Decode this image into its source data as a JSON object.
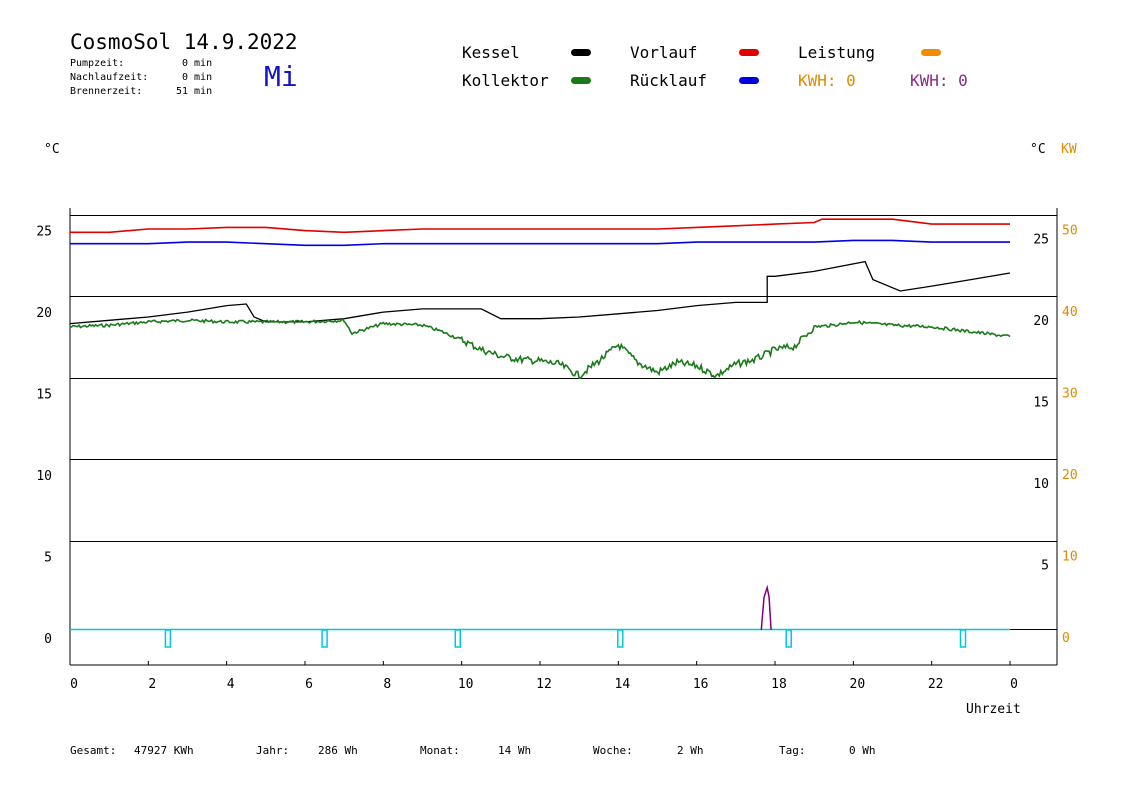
{
  "header": {
    "title": "CosmoSol 14.9.2022",
    "weekday": "Mi",
    "stats": [
      {
        "label": "Pumpzeit:",
        "value": "0 min"
      },
      {
        "label": "Nachlaufzeit:",
        "value": "0 min"
      },
      {
        "label": "Brennerzeit:",
        "value": "51 min"
      }
    ]
  },
  "legend": {
    "kessel": {
      "label": "Kessel",
      "color": "#000000"
    },
    "kollektor": {
      "label": "Kollektor",
      "color": "#1a7a1a"
    },
    "vorlauf": {
      "label": "Vorlauf",
      "color": "#e00000"
    },
    "ruecklauf": {
      "label": "Rücklauf",
      "color": "#0000e0"
    },
    "leistung": {
      "label": "Leistung",
      "color": "#f08c00"
    },
    "kwh_orange": "KWH: 0",
    "kwh_purple": "KWH: 0"
  },
  "colors": {
    "orange_text": "#e08a00",
    "purple_text": "#8a2a8a",
    "cyan": "#00c8d8",
    "purple_line": "#800080"
  },
  "axes": {
    "left_unit": "°C",
    "right_unit": "°C",
    "right_unit2": "KW",
    "xlabel": "Uhrzeit"
  },
  "footer": {
    "gesamt": {
      "label": "Gesamt:",
      "value": "47927 KWh"
    },
    "jahr": {
      "label": "Jahr:",
      "value": "286 Wh"
    },
    "monat": {
      "label": "Monat:",
      "value": "14 Wh"
    },
    "woche": {
      "label": "Woche:",
      "value": "2 Wh"
    },
    "tag": {
      "label": "Tag:",
      "value": "0 Wh"
    }
  },
  "chart_data": {
    "type": "line",
    "title": "CosmoSol 14.9.2022",
    "xlabel": "Uhrzeit",
    "ylabel": "°C",
    "xlim": [
      0,
      24
    ],
    "ylim": [
      -2,
      27
    ],
    "x_ticks": [
      "0",
      "2",
      "4",
      "6",
      "8",
      "10",
      "12",
      "14",
      "16",
      "18",
      "20",
      "22",
      "0"
    ],
    "x_tick_values": [
      0,
      2,
      4,
      6,
      8,
      10,
      12,
      14,
      16,
      18,
      20,
      22,
      24
    ],
    "y_ticks_left": [
      0,
      5,
      10,
      15,
      20,
      25
    ],
    "y_ticks_right_c": [
      5,
      10,
      15,
      20,
      25
    ],
    "y_ticks_right_kw": [
      0,
      10,
      20,
      30,
      40,
      50
    ],
    "grid": true,
    "series": [
      {
        "name": "Vorlauf",
        "color": "#e00000",
        "x": [
          0,
          1,
          2,
          3,
          4,
          5,
          6,
          7,
          8,
          9,
          10,
          11,
          12,
          13,
          14,
          15,
          16,
          17,
          18,
          19,
          19.2,
          20,
          21,
          22,
          23,
          24
        ],
        "values": [
          24.4,
          24.4,
          24.6,
          24.6,
          24.7,
          24.7,
          24.5,
          24.4,
          24.5,
          24.6,
          24.6,
          24.6,
          24.6,
          24.6,
          24.6,
          24.6,
          24.7,
          24.8,
          24.9,
          25.0,
          25.2,
          25.2,
          25.2,
          24.9,
          24.9,
          24.9
        ]
      },
      {
        "name": "Rücklauf",
        "color": "#0000e0",
        "x": [
          0,
          1,
          2,
          3,
          4,
          5,
          6,
          7,
          8,
          9,
          10,
          11,
          12,
          13,
          14,
          15,
          16,
          17,
          18,
          19,
          20,
          21,
          22,
          23,
          24
        ],
        "values": [
          23.7,
          23.7,
          23.7,
          23.8,
          23.8,
          23.7,
          23.6,
          23.6,
          23.7,
          23.7,
          23.7,
          23.7,
          23.7,
          23.7,
          23.7,
          23.7,
          23.8,
          23.8,
          23.8,
          23.8,
          23.9,
          23.9,
          23.8,
          23.8,
          23.8
        ]
      },
      {
        "name": "Kessel",
        "color": "#000000",
        "x": [
          0,
          1,
          2,
          3,
          4,
          4.5,
          4.7,
          5,
          6,
          7,
          8,
          9,
          10.5,
          11,
          12,
          13,
          14,
          15,
          16,
          17,
          17.8,
          17.8,
          18,
          19,
          20.3,
          20.5,
          21.2,
          22,
          23,
          24
        ],
        "values": [
          18.8,
          19.0,
          19.2,
          19.5,
          19.9,
          20.0,
          19.2,
          18.9,
          18.9,
          19.1,
          19.5,
          19.7,
          19.7,
          19.1,
          19.1,
          19.2,
          19.4,
          19.6,
          19.9,
          20.1,
          20.1,
          21.7,
          21.7,
          22.0,
          22.6,
          21.5,
          20.8,
          21.1,
          21.5,
          21.9
        ]
      },
      {
        "name": "Kollektor",
        "color": "#1a7a1a",
        "x": [
          0,
          1,
          2,
          3,
          4,
          5,
          6,
          7,
          7.2,
          8,
          9,
          9.5,
          10,
          10.5,
          11,
          11.5,
          12,
          12.5,
          13,
          13.5,
          14,
          14.5,
          15,
          15.5,
          16,
          16.5,
          17,
          17.5,
          18,
          18.5,
          19,
          19.5,
          20,
          21,
          22,
          23,
          24
        ],
        "values": [
          18.6,
          18.7,
          18.9,
          19.0,
          18.9,
          18.9,
          18.9,
          19.0,
          18.2,
          18.8,
          18.7,
          18.3,
          17.8,
          17.2,
          16.8,
          16.6,
          16.5,
          16.3,
          15.6,
          16.5,
          17.5,
          16.4,
          15.8,
          16.4,
          16.2,
          15.6,
          16.3,
          16.6,
          17.2,
          17.4,
          18.6,
          18.7,
          18.9,
          18.7,
          18.6,
          18.3,
          18.0
        ]
      },
      {
        "name": "Leistung",
        "color": "#f08c00",
        "x": [
          0,
          24
        ],
        "values": [
          0,
          0
        ]
      }
    ],
    "purple_spike": {
      "x": [
        17.65,
        17.72,
        17.8,
        17.85,
        17.9
      ],
      "values": [
        0,
        2.0,
        2.6,
        2.0,
        0
      ]
    },
    "cyan_markers_x": [
      2.5,
      6.5,
      9.9,
      14.05,
      18.35,
      22.8
    ]
  }
}
